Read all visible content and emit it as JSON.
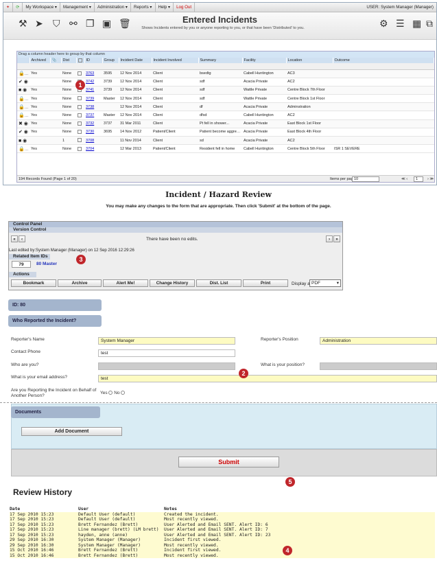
{
  "menubar": {
    "items": [
      "My Workspace ▾",
      "Management ▾",
      "Administration ▾",
      "Reports ▾",
      "Help ▾"
    ],
    "logout": "Log Out",
    "user": "USER: System Manager (Manager)"
  },
  "toolbar": {
    "title": "Entered Incidents",
    "subtitle": "Shows Incidents entered by you or anyone reporting to you, or that have been 'Distributed' to you."
  },
  "grid": {
    "group_hint": "Drag a column header here to group by that column",
    "columns": [
      "",
      "Archived",
      "",
      "Dist",
      "",
      "ID",
      "Group",
      "Incident Date",
      "Incident Involved",
      "Summary",
      "Facility",
      "Location",
      "Outcome"
    ],
    "rows": [
      {
        "archived": "Yes",
        "dist": "None",
        "id": "3763",
        "group": "3595",
        "date": "12 Nov 2014",
        "involved": "Client",
        "summary": "bsedtg",
        "facility": "Cabell Huntington",
        "location": "AC3",
        "outcome": ""
      },
      {
        "archived": "",
        "dist": "None",
        "id": "3742",
        "group": "3739",
        "date": "12 Nov 2014",
        "involved": "Client",
        "summary": "sdf",
        "facility": "Acacia Private",
        "location": "AC2",
        "outcome": ""
      },
      {
        "archived": "Yes",
        "dist": "None",
        "id": "3741",
        "group": "3739",
        "date": "12 Nov 2014",
        "involved": "Client",
        "summary": "sdf",
        "facility": "Wattle Private",
        "location": "Centre Block 7th Floor",
        "outcome": ""
      },
      {
        "archived": "Yes",
        "dist": "None",
        "id": "3739",
        "group": "Master",
        "date": "12 Nov 2014",
        "involved": "Client",
        "summary": "sdf",
        "facility": "Wattle Private",
        "location": "Centre Block 1st Floor",
        "outcome": ""
      },
      {
        "archived": "Yes",
        "dist": "None",
        "id": "3738",
        "group": "",
        "date": "12 Nov 2014",
        "involved": "Client",
        "summary": "df",
        "facility": "Acacia Private",
        "location": "Adminstration",
        "outcome": ""
      },
      {
        "archived": "Yes",
        "dist": "None",
        "id": "3737",
        "group": "Master",
        "date": "12 Nov 2014",
        "involved": "Client",
        "summary": "dfsd",
        "facility": "Cabell Huntington",
        "location": "AC2",
        "outcome": ""
      },
      {
        "archived": "Yes",
        "dist": "None",
        "id": "3732",
        "group": "3737",
        "date": "31 Mar 2011",
        "involved": "Client",
        "summary": "Pt fell in shower...",
        "facility": "Acacia Private",
        "location": "East Block 1st Floor",
        "outcome": ""
      },
      {
        "archived": "Yes",
        "dist": "None",
        "id": "3730",
        "group": "3695",
        "date": "14 Nov 2012",
        "involved": "Patient/Client",
        "summary": "Patient become aggress...",
        "facility": "Acacia Private",
        "location": "East Block 4th Floor",
        "outcome": ""
      },
      {
        "archived": "",
        "dist": "1",
        "id": "3708",
        "group": "",
        "date": "11 Nov 2014",
        "involved": "Client",
        "summary": "sd",
        "facility": "Acacia Private",
        "location": "AC2",
        "outcome": ""
      },
      {
        "archived": "Yes",
        "dist": "None",
        "id": "3704",
        "group": "",
        "date": "12 Mar 2013",
        "involved": "Patient/Client",
        "summary": "Resident fell in home",
        "facility": "Cabell Huntington",
        "location": "Centre Block 5th Floor",
        "outcome": "ISR 1 SEVERE"
      }
    ],
    "status": "194 Records Found (Page 1 of 20)",
    "items_per_page_label": "Items per page:",
    "items_per_page": "10",
    "page": "1"
  },
  "review": {
    "title": "Incident / Hazard Review",
    "instructions": "You may make any changes to the form that are appropriate. Then click 'Submit' at the bottom of the page."
  },
  "control_panel": {
    "title": "Control Panel",
    "version_control": "Version Control",
    "no_edits": "There have been no edits.",
    "last_edited": "Last edited by:System Manager (Manager) on 12 Sep 2016 12:29:26",
    "related_title": "Related Item IDs",
    "related_id": "79",
    "related_master": "80 Master",
    "actions_title": "Actions",
    "buttons": [
      "Bookmark",
      "Archive",
      "Alert Me!",
      "Change History",
      "Dist. List",
      "Print"
    ],
    "display_as_label": "Display as:",
    "display_as": "PDF"
  },
  "form": {
    "id_label": "ID: 80",
    "who_reported": "Who Reported the Incident?",
    "reporter_name_label": "Reporter's Name",
    "reporter_name": "System Manager",
    "reporter_position_label": "Reporter's Position",
    "reporter_position": "Administration",
    "contact_phone_label": "Contact Phone",
    "contact_phone": "test",
    "who_are_you_label": "Who are you?",
    "position_label": "What is your position?",
    "email_label": "What is your email address?",
    "email": "test",
    "on_behalf_label": "Are you Reporting the Incident on Behalf of Another Person?",
    "yes": "Yes",
    "no": "No"
  },
  "documents": {
    "title": "Documents",
    "add_button": "Add Document"
  },
  "submit": "Submit",
  "history": {
    "title": "Review History",
    "headers": [
      "Date",
      "User",
      "Notes"
    ],
    "rows": [
      [
        "17 Sep 2010 15:23",
        "Default User (default)",
        "Created the incident."
      ],
      [
        "17 Sep 2010 15:23",
        "Default User (default)",
        "Most recently viewed."
      ],
      [
        "17 Sep 2010 15:23",
        "Brett Fernandez (Brett)",
        "User Alerted and Email SENT. Alert ID: 6"
      ],
      [
        "17 Sep 2010 15:23",
        "Line manager (brett) (LM brett)",
        "User Alerted and Email SENT. Alert ID: 7"
      ],
      [
        "17 Sep 2010 15:23",
        "hayden, anne (anne)",
        "User Alerted and Email SENT. Alert ID: 23"
      ],
      [
        "29 Sep 2010 16:30",
        "System Manager (Manager)",
        "Incident first viewed."
      ],
      [
        "29 Sep 2010 16:30",
        "System Manager (Manager)",
        "Most recently viewed."
      ],
      [
        "15 Oct 2010 16:46",
        "Brett Fernandez (Brett)",
        "Incident first viewed."
      ],
      [
        "15 Oct 2010 16:46",
        "Brett Fernandez (Brett)",
        "Most recently viewed."
      ]
    ]
  },
  "badges": [
    "1",
    "2",
    "3",
    "4",
    "5"
  ],
  "colors": {
    "badge": "#c0262b",
    "section": "#a4b5cd",
    "highlight": "#fdfbc2",
    "submit": "#cc0000"
  }
}
